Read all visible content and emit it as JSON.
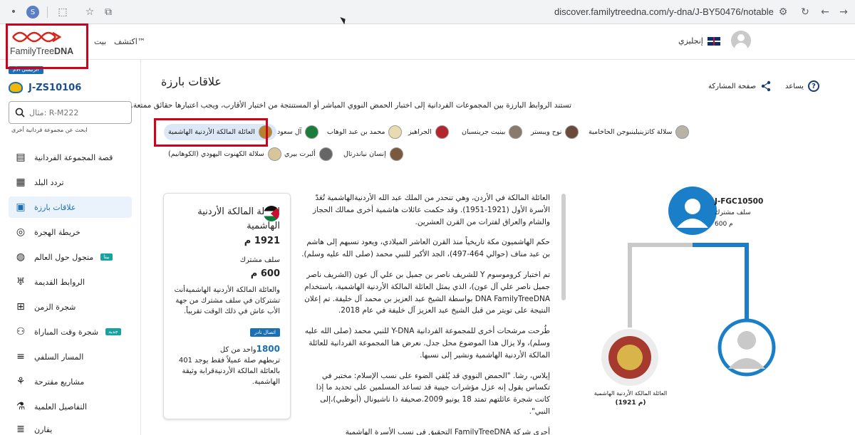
{
  "browser": {
    "profile_initial": "S",
    "url": "discover.familytreedna.com/y-dna/J-BY50476/notable"
  },
  "header": {
    "logo_text_a": "FamilyTree",
    "logo_text_b": "DNA",
    "nav_home": "بيت",
    "nav_explore": "اكتشف™",
    "language": "إنجليزي"
  },
  "sidebar": {
    "badge": "الرئيسي الأم",
    "haplogroup": "J-ZS10106",
    "search_placeholder": "مثال: R-M222",
    "search_hint": "ابحث عن مجموعة فردانية أخرى",
    "items": [
      {
        "label": "قصة المجموعة الفردانية",
        "icon": "book-icon"
      },
      {
        "label": "تردد البلد",
        "icon": "map-icon"
      },
      {
        "label": "علاقات بارزة",
        "icon": "notable-icon"
      },
      {
        "label": "خريطة الهجرة",
        "icon": "compass-icon"
      },
      {
        "label": "متجول حول العالم",
        "icon": "globe-icon",
        "tag": "بيتا"
      },
      {
        "label": "الروابط القديمة",
        "icon": "ancient-icon"
      },
      {
        "label": "شجرة الزمن",
        "icon": "time-tree-icon"
      },
      {
        "label": "شجرة وقت المباراة",
        "icon": "people-icon",
        "tag": "جديد"
      },
      {
        "label": "المسار السلفي",
        "icon": "path-icon"
      },
      {
        "label": "مشاريع مقترحة",
        "icon": "projects-icon"
      },
      {
        "label": "التفاصيل العلمية",
        "icon": "microscope-icon"
      },
      {
        "label": "يقارن",
        "icon": "compare-icon"
      }
    ]
  },
  "main": {
    "title": "علاقات بارزة",
    "help": "يساعد",
    "share": "صفحة المشاركة",
    "description": "تستند الروابط البارزة بين المجموعات الفردانية إلى اختبار الحمض النووي المباشر أو المستنتجة من اختبار الأقارب، ويجب اعتبارها حقائق ممتعة.",
    "chips": [
      "العائلة المالكة الأردنية الهاشمية",
      "آل سعود",
      "محمد بن عبد الوهاب",
      "الجراهيز",
      "بينيت جرينسبان",
      "نوح ويبستر",
      "سلالة كاتزينيلينبوجن الحاخامية",
      "سلالة الكهنوت اليهودي (الكوهانيم)",
      "ألبرت بيري",
      "إنسان نياندرتال"
    ]
  },
  "card": {
    "title": "العائلة المالكة الأردنية الهاشمية",
    "year": "1921 م",
    "common_label": "سلف مشترك",
    "common_value": "600 م",
    "text": "والعائلة المالكة الأردنية الهاشميةأنت تشتركان في سلف مشترك من جهة الأب عاش في ذلك الوقت تقريباً.",
    "badge": "اتصال نادر",
    "number": "1800",
    "text2a": "واحد من كل",
    "text2b": "تربطهم صلة عميلاً فقط يوجد 401 بالعائلة المالكة الأردنيةقرابة وثيقة الهاشمية."
  },
  "article": [
    "العائلة المالكة في الأردن، وهي تنحدر من الملك عبد الله الأردنيةالهاشمية تُعَدّ الأسرة الأول (1921-1951). وقد حكمت عائلات هاشمية أخرى ممالك الحجاز والشام والعراق لفترات من القرن العشرين.",
    "حكم الهاشميون مكة تاريخياً منذ القرن العاشر الميلادي، ويعود نسبهم إلى هاشم بن عبد مناف (حوالي 464-497)، الجد الأكبر للنبي محمد (صلى الله عليه وسلم).",
    "تم اختبار كروموسوم Y للشريف ناصر بن جميل بن علي آل عون (الشريف ناصر جميل ناصر علي آل عون)، الذي يمثل العائلة المالكة الأردنية الهاشمية، باستخدام DNA FamilyTreeDNA بواسطة الشيخ عبد العزيز بن محمد آل خليفة. تم إعلان النتيجة على تويتر من قبل الشيخ عبد العزيز آل خليفة في عام 2018.",
    "طُرحت مرشحات أخرى للمجموعة الفردانية Y-DNA للنبي محمد (صلى الله عليه وسلم)، ولا يزال هذا الموضوع محل جدل. نعرض هنا المجموعة الفردانية للعائلة المالكة الأردنية الهاشمية ونشير إلى نسبها.",
    "إيلاس، رشا. \"الحمض النووي قد يُلقي الضوء على نسب الإسلام: مختبر في تكساس يقول إنه عزل مؤشرات جينية قد تساعد المسلمين على تحديد ما إذا كانت شجرة عائلتهم تمتد 18 يونيو 2009.صحيفة ذا ناشيونال (أبوظبي)،إلى النبي\".",
    "أجرى شركة FamilyTreeDNA التحقيق في نسب الأسرة الهاشمية"
  ],
  "tree": {
    "node_name": "J-FGC10500",
    "node_sub": "سلف مشترك",
    "node_age": "600 م",
    "leaf_label": "العائلة المالكة الأردنية الهاشمية",
    "leaf_year": "(1921 م)"
  },
  "colors": {
    "accent": "#1a6fb5",
    "highlight": "#d0021b"
  }
}
